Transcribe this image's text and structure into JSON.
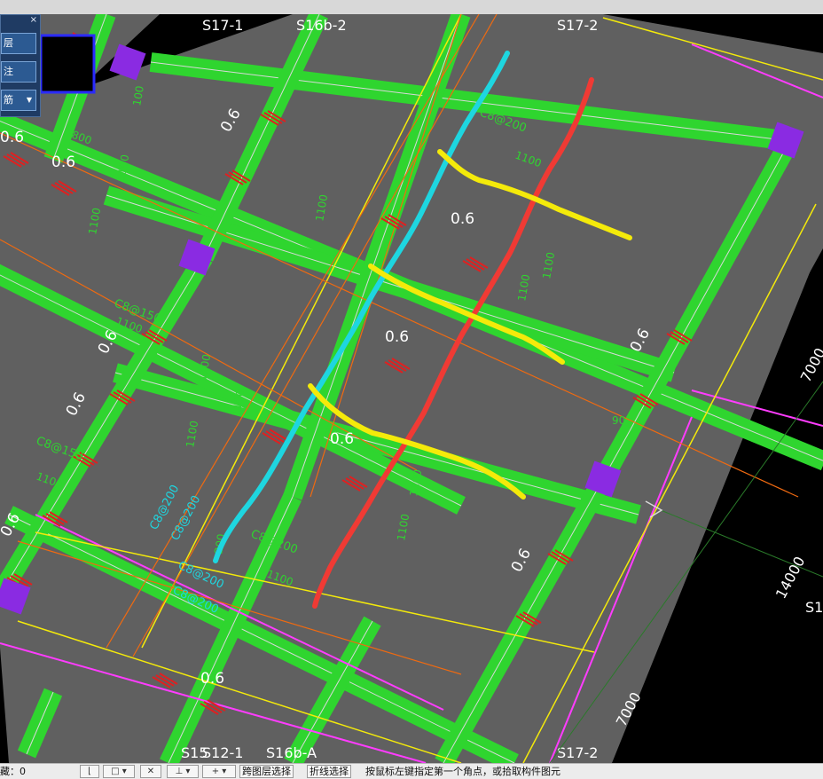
{
  "panel": {
    "close_glyph": "×",
    "buttons": [
      {
        "label": "层"
      },
      {
        "label": "注"
      },
      {
        "label": "筋"
      }
    ]
  },
  "axes": {
    "top": [
      "S17-1",
      "S16b-2",
      "S17-2"
    ],
    "bottom": [
      "S15",
      "S12-1",
      "S16b-A",
      "S17-2"
    ],
    "right": "S1"
  },
  "dimensions": [
    "7000",
    "14000",
    "7000"
  ],
  "slope_labels": [
    "0.6",
    "0.6",
    "0.6",
    "0.6",
    "0.6",
    "0.6",
    "0.6",
    "0.6",
    "0.6",
    "0.6",
    "0.6",
    "0.6"
  ],
  "rebar_labels": [
    "C8@150",
    "C8@150",
    "C8@200",
    "C8@200",
    "C8@200",
    "C8@200",
    "C8@200",
    "C8@200"
  ],
  "length_labels": [
    "1100",
    "1100",
    "1100",
    "1100",
    "1100",
    "1100",
    "1100",
    "1100",
    "1100",
    "1100",
    "1100",
    "1100",
    "1100",
    "800",
    "100",
    "90",
    "200",
    "1100"
  ],
  "status": {
    "left_text": "藏：0",
    "btn_cross_layer": "跨图层选择",
    "btn_polyline": "折线选择",
    "prompt": "按鼠标左键指定第一个角点，或拾取构件图元"
  }
}
